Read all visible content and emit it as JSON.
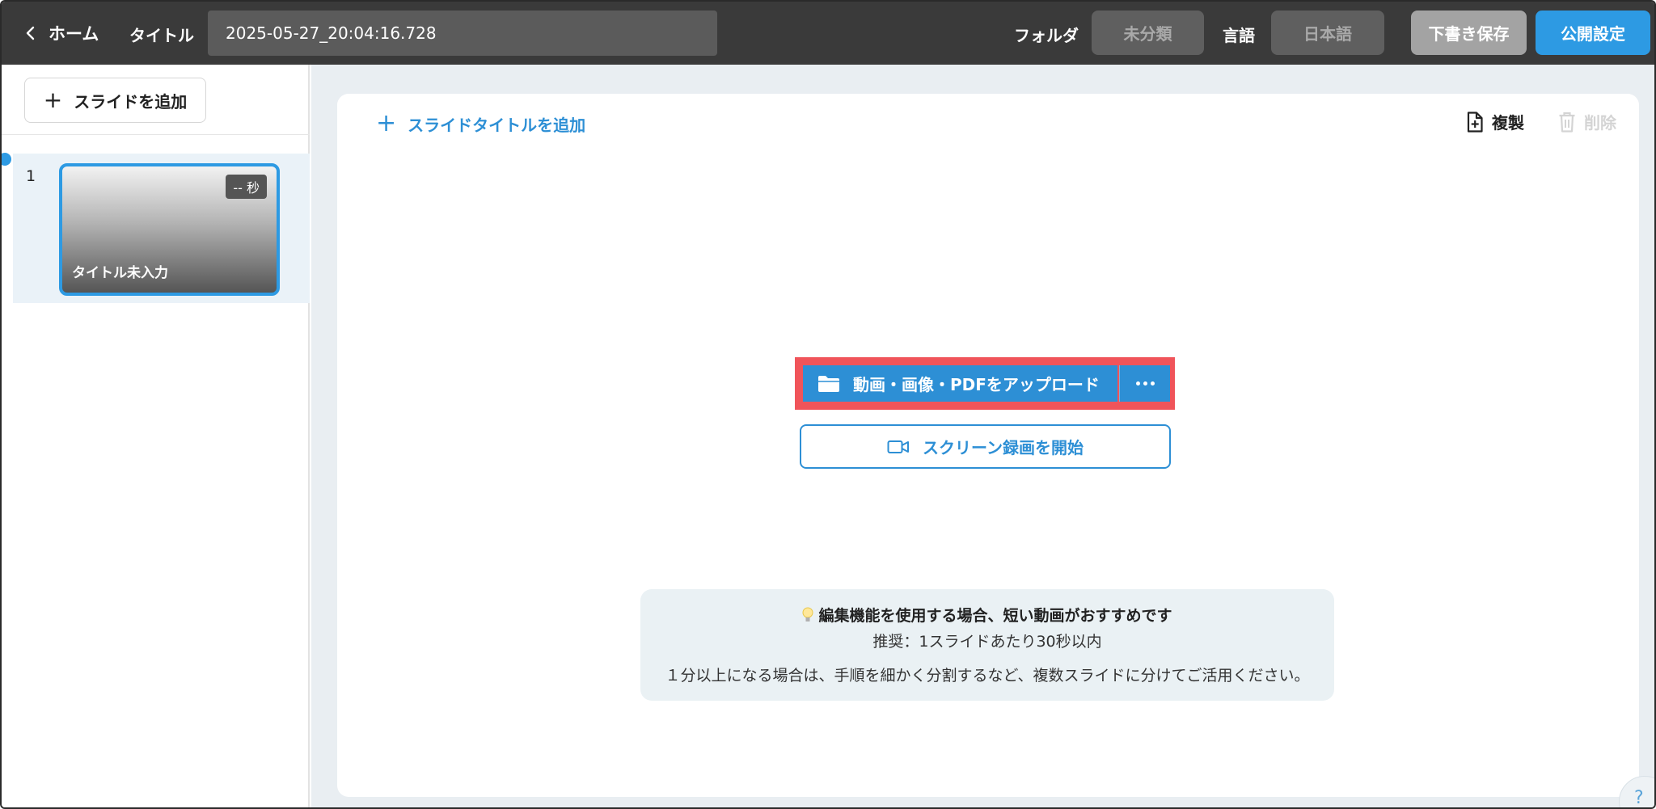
{
  "header": {
    "back_label": "ホーム",
    "title_label": "タイトル",
    "title_value": "2025-05-27_20:04:16.728",
    "folder_label": "フォルダ",
    "folder_value": "未分類",
    "language_label": "言語",
    "language_value": "日本語",
    "draft_save_label": "下書き保存",
    "publish_settings_label": "公開設定",
    "colors": {
      "bar": "#3a3a3a",
      "primary": "#2d9ae3"
    }
  },
  "sidebar": {
    "add_slide_label": "スライドを追加",
    "slides": [
      {
        "number": "1",
        "duration": "-- 秒",
        "title": "タイトル未入力",
        "selected": true
      }
    ]
  },
  "editor": {
    "add_slide_title_label": "スライドタイトルを追加",
    "duplicate_label": "複製",
    "delete_label": "削除",
    "upload_label": "動画・画像・PDFをアップロード",
    "more_icon": "more-horizontal-icon",
    "screen_record_label": "スクリーン録画を開始",
    "highlight_color": "#f0545a"
  },
  "tip": {
    "title": "編集機能を使用する場合、短い動画がおすすめです",
    "line1": "推奨：1スライドあたり30秒以内",
    "line2": "１分以上になる場合は、手順を細かく分割するなど、複数スライドに分けてご活用ください。"
  },
  "help": {
    "label": "?"
  }
}
